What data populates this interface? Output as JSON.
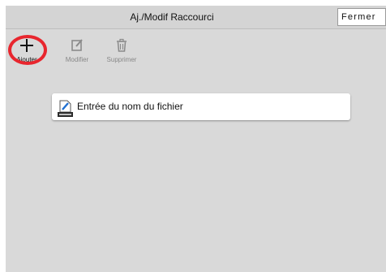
{
  "header": {
    "title": "Aj./Modif Raccourci",
    "close_label": "Fermer"
  },
  "toolbar": {
    "add_label": "Ajouter",
    "modify_label": "Modifier",
    "delete_label": "Supprimer"
  },
  "entries": [
    {
      "label": "Entrée du nom du fichier",
      "icon": "file-name-icon"
    }
  ],
  "colors": {
    "highlight": "#e8262e",
    "panel": "#d9d9d9"
  }
}
